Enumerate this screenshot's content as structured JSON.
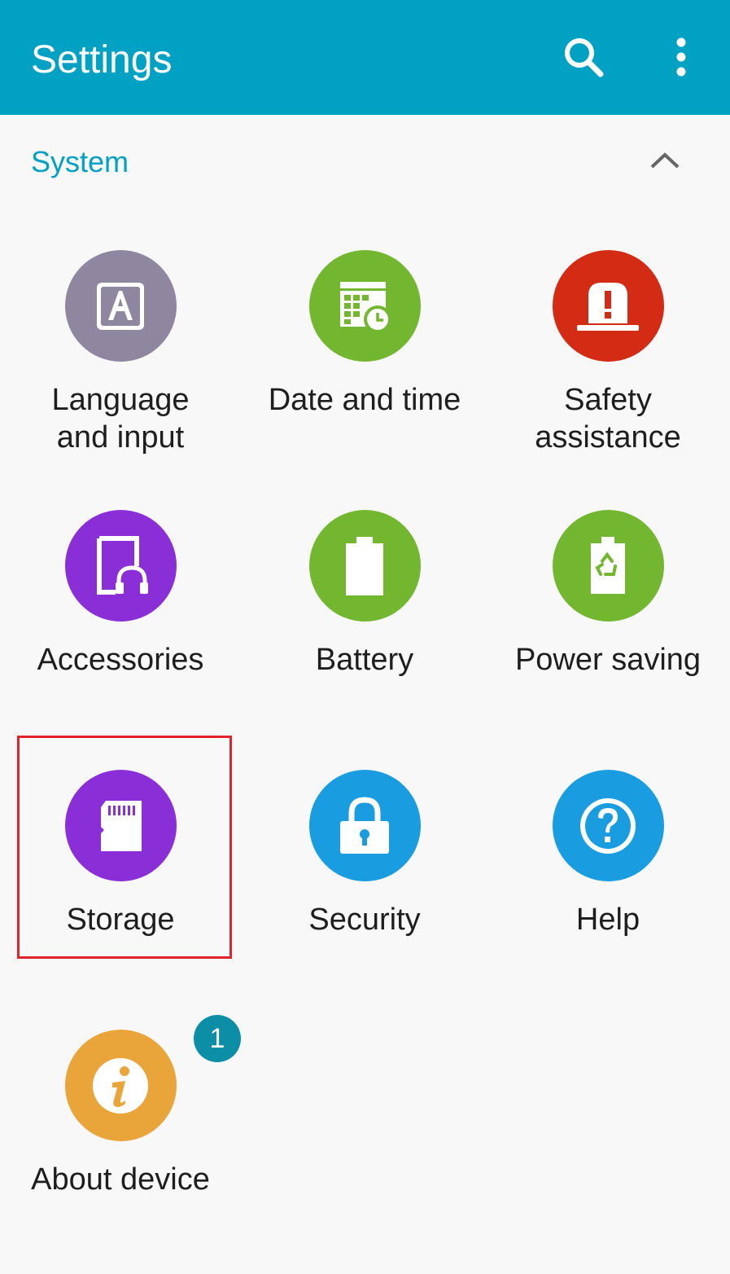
{
  "appbar": {
    "title": "Settings",
    "search_icon": "search-icon",
    "more_icon": "more-vertical-icon",
    "color": "#00a1c3"
  },
  "section": {
    "title": "System",
    "collapse_icon": "chevron-up-icon"
  },
  "items": [
    {
      "label": "Language\nand input",
      "icon": "language-icon",
      "color": "#8f87a0"
    },
    {
      "label": "Date and time",
      "icon": "calendar-clock-icon",
      "color": "#73b62f"
    },
    {
      "label": "Safety\nassistance",
      "icon": "alert-beacon-icon",
      "color": "#d42b14"
    },
    {
      "label": "Accessories",
      "icon": "accessories-icon",
      "color": "#8a2fd7"
    },
    {
      "label": "Battery",
      "icon": "battery-icon",
      "color": "#73b62f"
    },
    {
      "label": "Power saving",
      "icon": "power-saving-icon",
      "color": "#73b62f"
    },
    {
      "label": "Storage",
      "icon": "sd-card-icon",
      "color": "#8a2fd7",
      "highlighted": true
    },
    {
      "label": "Security",
      "icon": "lock-icon",
      "color": "#1a9de0"
    },
    {
      "label": "Help",
      "icon": "help-icon",
      "color": "#1a9de0"
    },
    {
      "label": "About device",
      "icon": "info-icon",
      "color": "#eaa53a",
      "badge": "1"
    }
  ],
  "highlight_color": "#e0242e"
}
